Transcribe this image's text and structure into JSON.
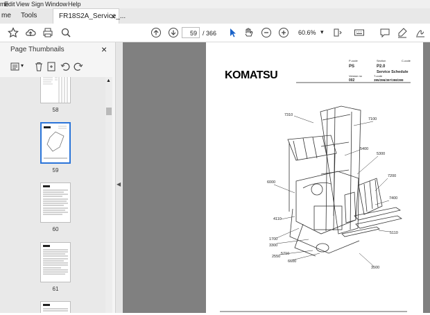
{
  "menu": {
    "items": [
      "me",
      "Edit",
      "View",
      "Sign",
      "Window",
      "Help"
    ]
  },
  "tabs": {
    "home": "me",
    "tools": "Tools",
    "doc": "FR18S2A_Service_...",
    "close": "×"
  },
  "toolbar": {
    "current_page": "59",
    "total_pages": "/ 366",
    "zoom": "60.6%"
  },
  "sidebar": {
    "title": "Page Thumbnails",
    "close": "×"
  },
  "thumbnails": [
    {
      "label": "58"
    },
    {
      "label": "59"
    },
    {
      "label": "60"
    },
    {
      "label": "61"
    }
  ],
  "page": {
    "logo": "KOMATSU",
    "header": {
      "pcode_label": "P-code",
      "pcode": "PS",
      "section_label": "Section",
      "section": "P2.0",
      "section_title": "Service Schedule",
      "ccode_label": "C-code",
      "version_label": "Version no",
      "version": "002",
      "tcode_label": "T-code",
      "tcode": "395/396/397/398/399"
    },
    "callouts": [
      "7310",
      "7100",
      "5400",
      "5300",
      "6000",
      "7200",
      "7400",
      "4110",
      "5110",
      "1700",
      "3300",
      "2550",
      "5710",
      "6600",
      "3500"
    ]
  },
  "colors": {
    "accent": "#2a74d9",
    "doc_bg": "#808080"
  }
}
